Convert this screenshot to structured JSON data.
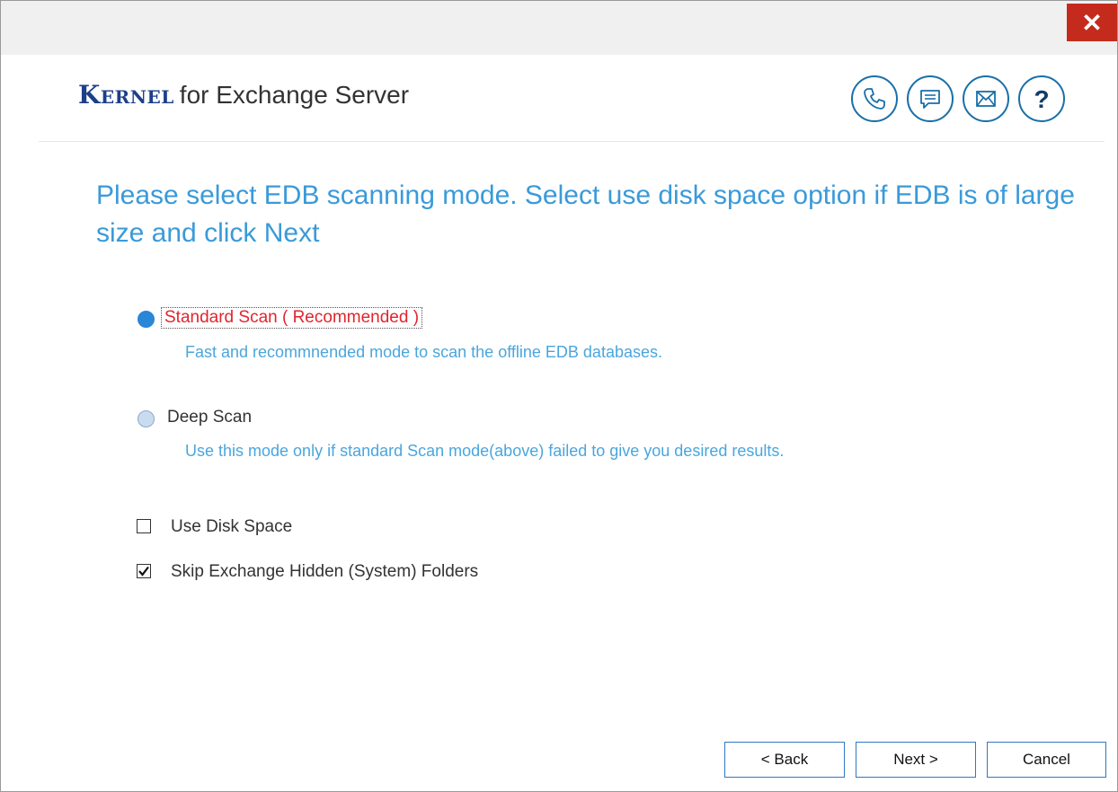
{
  "window": {
    "close_label": "✕"
  },
  "header": {
    "brand": "Kernel",
    "product": "for Exchange Server"
  },
  "heading": "Please select EDB scanning mode. Select use disk space option if EDB is of large size and click Next",
  "options": [
    {
      "label": "Standard Scan ( Recommended )",
      "description": "Fast and recommnended mode to scan the offline EDB databases.",
      "selected": true
    },
    {
      "label": "Deep Scan",
      "description": "Use this mode only if standard Scan mode(above) failed to give you desired results.",
      "selected": false
    }
  ],
  "checkboxes": [
    {
      "label": "Use Disk Space",
      "checked": false
    },
    {
      "label": "Skip Exchange Hidden (System) Folders",
      "checked": true
    }
  ],
  "buttons": {
    "back": "< Back",
    "next": "Next >",
    "cancel": "Cancel"
  },
  "icons": [
    "phone-icon",
    "chat-icon",
    "mail-icon",
    "help-icon"
  ],
  "colors": {
    "accent": "#3a9ad9",
    "selected_label": "#e0252f",
    "close": "#c42b1c",
    "icon_stroke": "#1a6fa8"
  }
}
